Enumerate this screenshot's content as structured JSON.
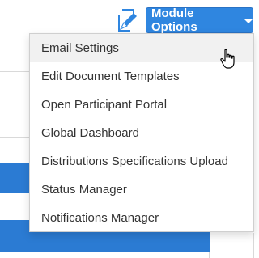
{
  "toolbar": {
    "module_options_label": "Module Options"
  },
  "menu": {
    "items": [
      {
        "label": "Email Settings"
      },
      {
        "label": "Edit Document Templates"
      },
      {
        "label": "Open Participant Portal"
      },
      {
        "label": "Global Dashboard"
      },
      {
        "label": "Distributions Specifications Upload"
      },
      {
        "label": "Status Manager"
      },
      {
        "label": "Notifications Manager"
      }
    ]
  },
  "icons": {
    "edit": "edit-icon",
    "caret": "caret-down-icon",
    "cursor": "hand-pointer-icon"
  },
  "colors": {
    "accent": "#2f86e0",
    "page_bar": "#2b7bd3",
    "menu_hover": "#f1f1f1",
    "menu_text": "#333333"
  }
}
